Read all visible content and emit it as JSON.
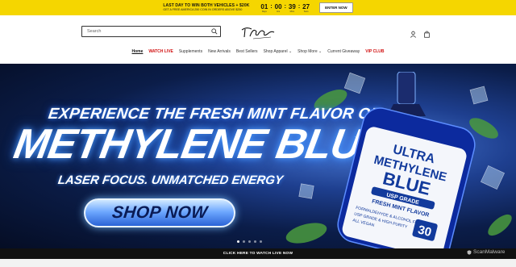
{
  "topbar": {
    "line1": "LAST DAY TO WIN BOTH VEHICLES + $20K",
    "line2": "GET A FREE AMERICA 250 COIN IN ORDERS ABOVE $250",
    "timer": [
      {
        "value": "01",
        "label": "Days"
      },
      {
        "value": "00",
        "label": "Hrs"
      },
      {
        "value": "39",
        "label": "Mins"
      },
      {
        "value": "27",
        "label": "Secs"
      }
    ],
    "enter_label": "ENTER NOW"
  },
  "header": {
    "search_placeholder": "Search",
    "nav": [
      {
        "label": "Home"
      },
      {
        "label": "WATCH LIVE"
      },
      {
        "label": "Supplements"
      },
      {
        "label": "New Arrivals"
      },
      {
        "label": "Best Sellers"
      },
      {
        "label": "Shop Apparel ⌄"
      },
      {
        "label": "Shop More ⌄"
      },
      {
        "label": "Current Giveaway"
      },
      {
        "label": "VIP CLUB"
      }
    ]
  },
  "hero": {
    "headline_top": "EXPERIENCE THE FRESH MINT FLAVOR OF",
    "headline_main": "METHYLENE BLUE",
    "headline_sub": "LASER FOCUS. UNMATCHED ENERGY",
    "cta_label": "SHOP NOW",
    "bottle": {
      "line1": "ULTRA",
      "line2": "METHYLENE",
      "line3": "BLUE",
      "grade": "USP GRADE",
      "flavor": "FRESH MINT FLAVOR",
      "bullets": [
        "FORMALDEHYDE & ALCOHOL FREE",
        "USP GRADE & HIGH PURITY",
        "ALL VEGAN"
      ],
      "count": "30"
    }
  },
  "footer_bar": {
    "label": "CLICK HERE TO WATCH LIVE NOW"
  },
  "watermark": "ScanMalware",
  "colors": {
    "topbar": "#f5d600",
    "accent_red": "#d10f0f",
    "hero_blue": "#1e3f8f"
  }
}
